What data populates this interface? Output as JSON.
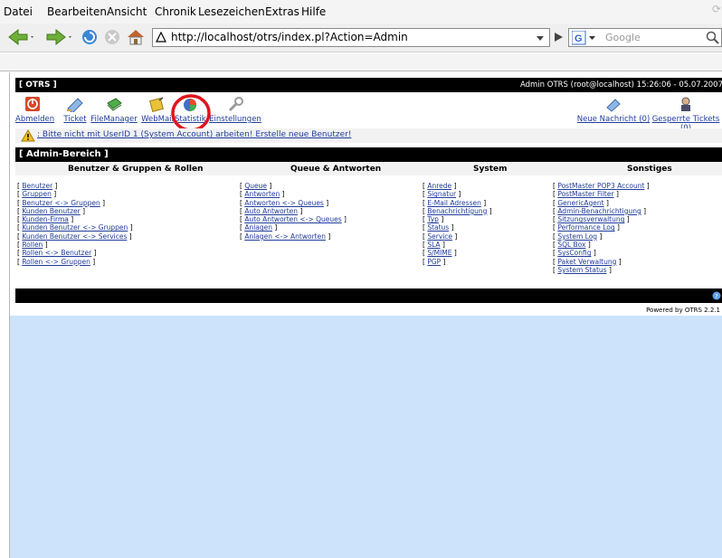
{
  "browser": {
    "menu": [
      "Datei",
      "Bearbeiten",
      "Ansicht",
      "Chronik",
      "Lesezeichen",
      "Extras",
      "Hilfe"
    ],
    "url": "http://localhost/otrs/index.pl?Action=Admin",
    "search_placeholder": "Google"
  },
  "otrs": {
    "brand": "[ OTRS ]",
    "user_info": "Admin OTRS (root@localhost) 15:26:06 - 05.07.2007",
    "nav": [
      "Abmelden",
      "Ticket",
      "FileManager",
      "WebMail",
      "Statistik",
      "Einstellungen"
    ],
    "nav_right": [
      "Neue Nachricht (0)",
      "Gesperrte Tickets (0)"
    ],
    "warning": ": Bitte nicht mit UserID 1 (System Account) arbeiten! Erstelle neue Benutzer!",
    "section_title": "[ Admin-Bereich ]",
    "columns": [
      {
        "title": "Benutzer & Gruppen & Rollen",
        "items": [
          "Benutzer",
          "Gruppen",
          "Benutzer <-> Gruppen",
          "Kunden Benutzer",
          "Kunden-Firma",
          "Kunden Benutzer <-> Gruppen",
          "Kunden Benutzer <-> Services",
          "Rollen",
          "Rollen <-> Benutzer",
          "Rollen <-> Gruppen"
        ]
      },
      {
        "title": "Queue & Antworten",
        "items": [
          "Queue",
          "Antworten",
          "Antworten <-> Queues",
          "Auto Antworten",
          "Auto Antworten <-> Queues",
          "Anlagen",
          "Anlagen <-> Antworten"
        ]
      },
      {
        "title": "System",
        "items": [
          "Anrede",
          "Signatur",
          "E-Mail Adressen",
          "Benachrichtigung",
          "Typ",
          "Status",
          "Service",
          "SLA",
          "S/MIME",
          "PGP"
        ]
      },
      {
        "title": "Sonstiges",
        "items": [
          "PostMaster POP3 Account",
          "PostMaster Filter",
          "GenericAgent",
          "Admin-Benachrichtigung",
          "Sitzungsverwaltung",
          "Performance Log",
          "System Log",
          "SQL Box",
          "SysConfig",
          "Paket Verwaltung",
          "System Status"
        ]
      }
    ],
    "powered": "Powered by OTRS 2.2.1"
  },
  "colors": {
    "link": "#1f3c9a",
    "highlight_circle": "#e0141e",
    "background_blue": "#cce3fb"
  }
}
